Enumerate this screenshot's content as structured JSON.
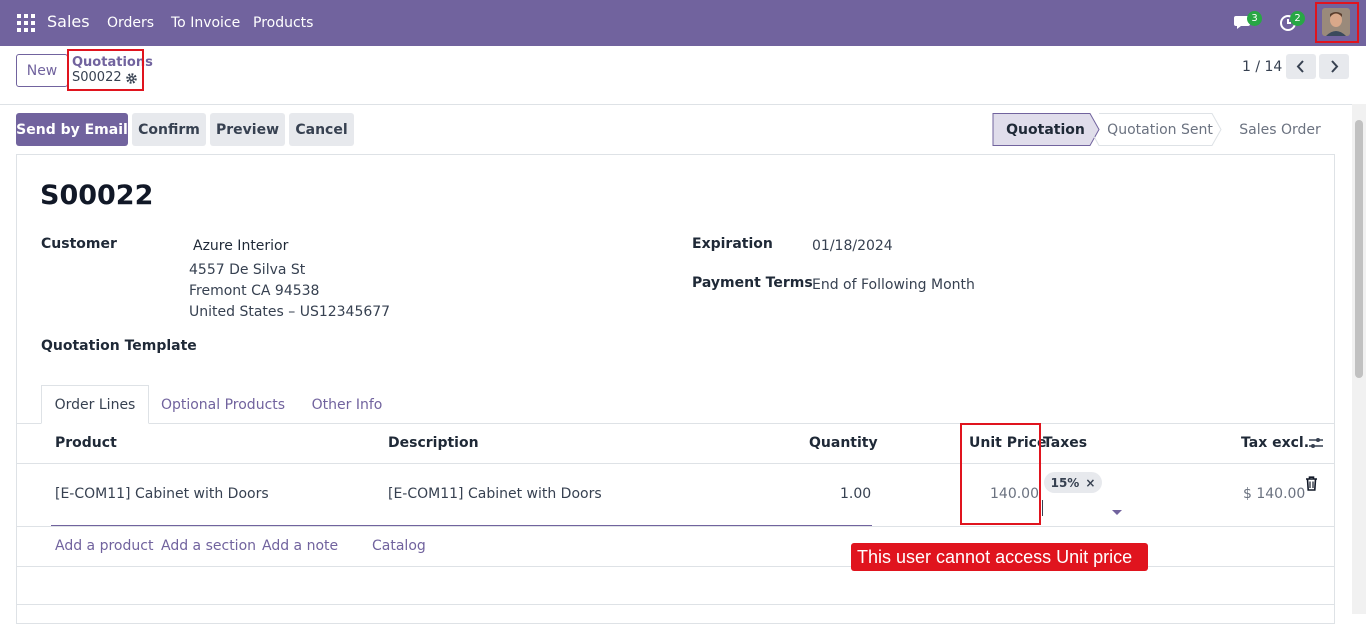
{
  "navbar": {
    "app_name": "Sales",
    "menu": [
      "Orders",
      "To Invoice",
      "Products"
    ],
    "messages_count": "3",
    "activities_count": "2",
    "accent": "#71639e"
  },
  "control_panel": {
    "new_label": "New",
    "breadcrumb_parent": "Quotations",
    "breadcrumb_current": "S00022",
    "pager": "1 / 14"
  },
  "actions": {
    "send_email": "Send by Email",
    "confirm": "Confirm",
    "preview": "Preview",
    "cancel": "Cancel"
  },
  "stages": [
    "Quotation",
    "Quotation Sent",
    "Sales Order"
  ],
  "form": {
    "title": "S00022",
    "customer_label": "Customer",
    "customer_name": "Azure Interior",
    "address_line1": "4557 De Silva St",
    "address_line2": "Fremont CA 94538",
    "address_line3": "United States – US12345677",
    "template_label": "Quotation Template",
    "expiration_label": "Expiration",
    "expiration_value": "01/18/2024",
    "payment_terms_label": "Payment Terms",
    "payment_terms_value": "End of Following Month"
  },
  "tabs": [
    "Order Lines",
    "Optional Products",
    "Other Info"
  ],
  "order_lines": {
    "columns": {
      "product": "Product",
      "description": "Description",
      "quantity": "Quantity",
      "unit_price": "Unit Price",
      "taxes": "Taxes",
      "tax_excl": "Tax excl."
    },
    "rows": [
      {
        "product": "[E-COM11] Cabinet with Doors",
        "description": "[E-COM11] Cabinet with Doors",
        "quantity": "1.00",
        "unit_price": "140.00",
        "tax": "15%",
        "tax_excl": "$ 140.00"
      }
    ],
    "add_product": "Add a product",
    "add_section": "Add a section",
    "add_note": "Add a note",
    "catalog": "Catalog"
  },
  "annotation": {
    "message": "This user cannot access Unit price",
    "color": "#e0141e"
  }
}
